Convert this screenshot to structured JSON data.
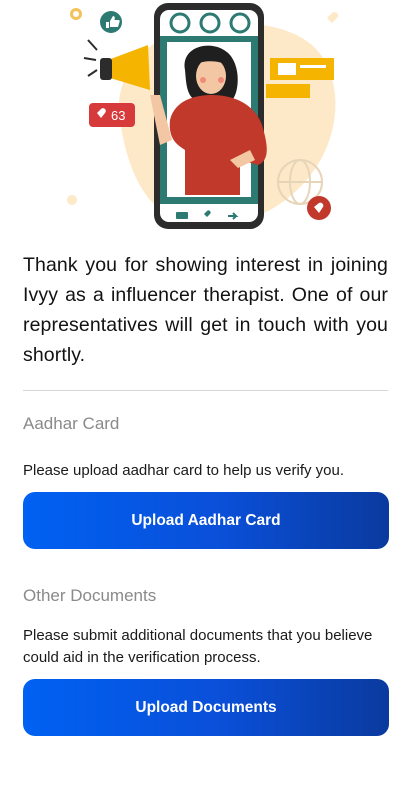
{
  "hero": {
    "like_count": "63",
    "illustration": "woman-with-megaphone-on-phone-illustration"
  },
  "intro": {
    "message": "Thank you for showing interest in joining Ivyy as a influencer therapist. One of our representatives will get in touch with you shortly."
  },
  "aadhar": {
    "title": "Aadhar Card",
    "description": "Please upload aadhar card to help us verify you.",
    "button_label": "Upload Aadhar Card"
  },
  "other_documents": {
    "title": "Other Documents",
    "description": "Please submit additional documents that you believe could aid in the verification process.",
    "button_label": "Upload Documents"
  },
  "colors": {
    "button_gradient_start": "#0061f2",
    "button_gradient_end": "#0a3a9e",
    "section_title": "#8a8a8a"
  }
}
